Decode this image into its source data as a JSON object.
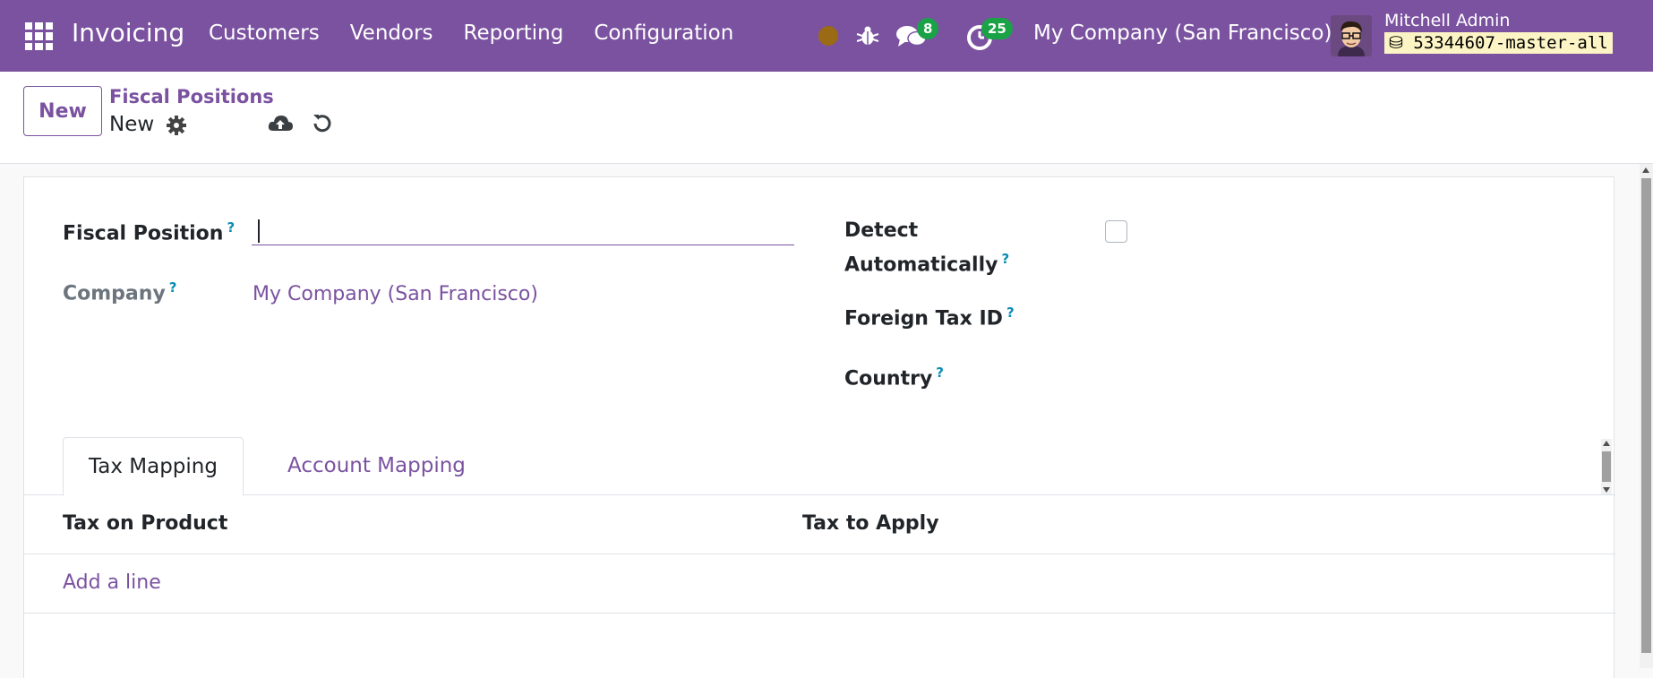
{
  "navbar": {
    "app_title": "Invoicing",
    "menu": [
      {
        "label": "Customers"
      },
      {
        "label": "Vendors"
      },
      {
        "label": "Reporting"
      },
      {
        "label": "Configuration"
      }
    ],
    "chat_count": "8",
    "activity_count": "25",
    "company": "My Company (San Francisco)",
    "user_name": "Mitchell Admin",
    "database": "53344607-master-all",
    "status_color": "#9a6a14",
    "brand_color": "#7a52a0"
  },
  "control_panel": {
    "new_label": "New",
    "breadcrumb": "Fiscal Positions",
    "record_name": "New"
  },
  "form": {
    "fiscal_position_label": "Fiscal Position",
    "fiscal_position_value": "",
    "company_label": "Company",
    "company_value": "My Company (San Francisco)",
    "detect_label_line1": "Detect",
    "detect_label_line2": "Automatically",
    "detect_checked": false,
    "foreign_tax_label": "Foreign Tax ID",
    "country_label": "Country",
    "help_mark": "?"
  },
  "tabs": [
    {
      "label": "Tax Mapping",
      "active": true
    },
    {
      "label": "Account Mapping",
      "active": false
    }
  ],
  "tax_table": {
    "columns": [
      "Tax on Product",
      "Tax to Apply"
    ],
    "add_line_label": "Add a line"
  }
}
